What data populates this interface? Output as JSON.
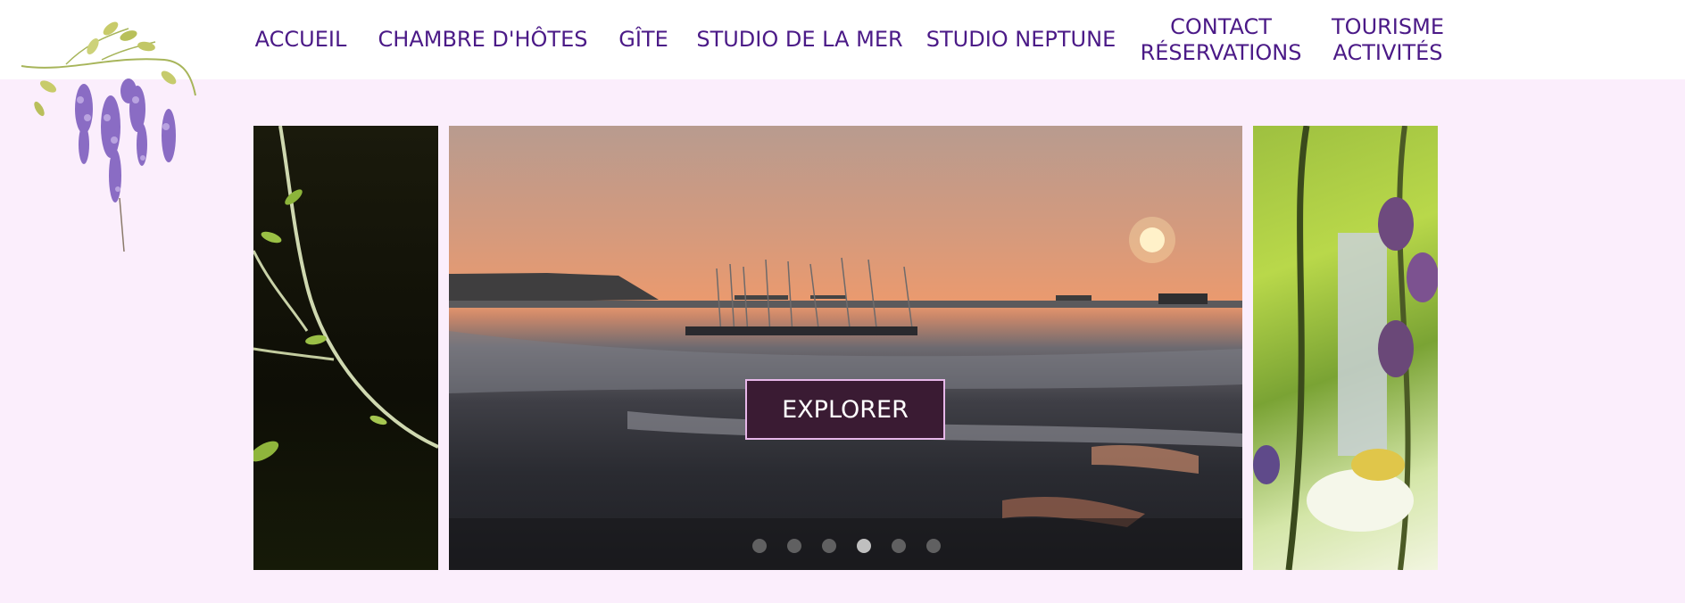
{
  "nav": {
    "items": [
      {
        "id": "accueil",
        "lines": [
          "ACCUEIL"
        ]
      },
      {
        "id": "chambre",
        "lines": [
          "CHAMBRE D'HÔTES"
        ]
      },
      {
        "id": "gite",
        "lines": [
          "GÎTE"
        ]
      },
      {
        "id": "studio-mer",
        "lines": [
          "STUDIO DE LA MER"
        ]
      },
      {
        "id": "studio-neptune",
        "lines": [
          "STUDIO NEPTUNE"
        ]
      },
      {
        "id": "contact",
        "lines": [
          "CONTACT",
          "RÉSERVATIONS"
        ]
      },
      {
        "id": "tourisme",
        "lines": [
          "TOURISME",
          "ACTIVITÉS"
        ]
      }
    ]
  },
  "hero": {
    "explore_label": "EXPLORER",
    "slide_count": 6,
    "active_slide": 4
  },
  "colors": {
    "nav_text": "#4b1a87",
    "page_background": "#fbeefc",
    "button_background": "#3a1b33",
    "button_border": "#e7b7e9"
  }
}
